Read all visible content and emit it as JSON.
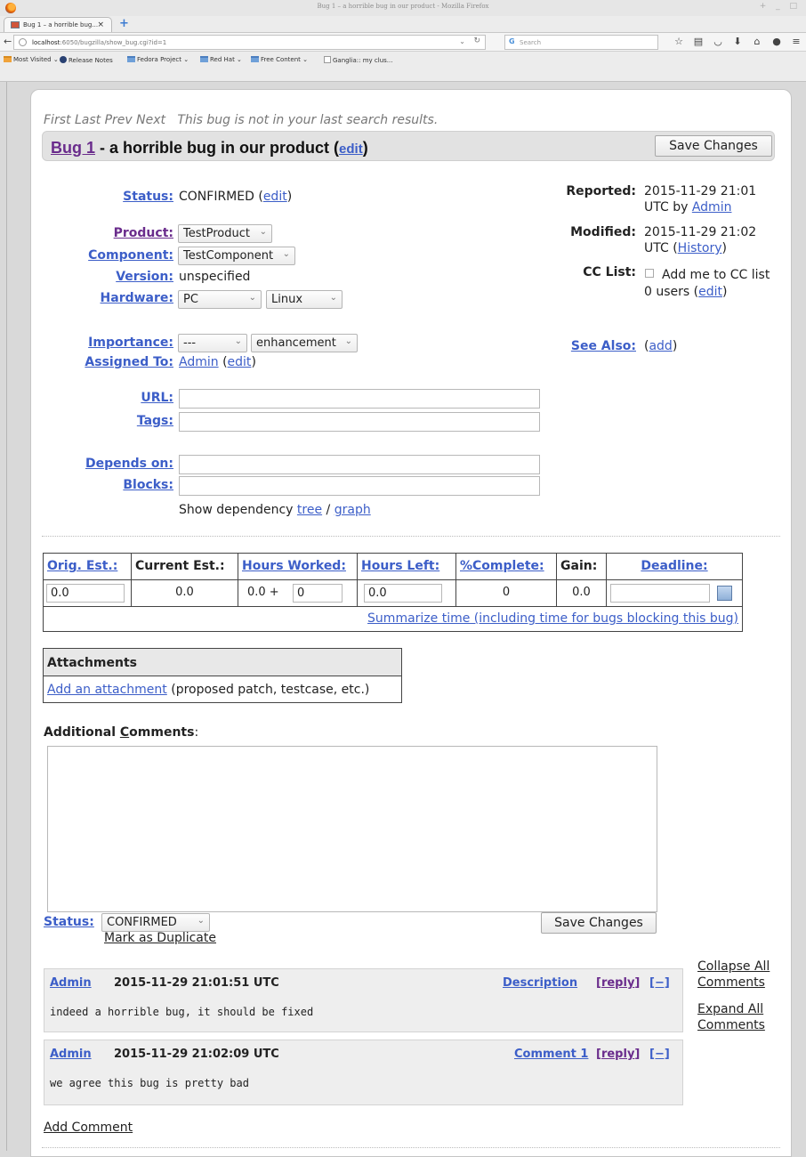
{
  "browser": {
    "window_title": "Bug 1 – a horrible bug in our product - Mozilla Firefox",
    "window_controls": "+ _ □",
    "tab_title": "Bug 1 – a horrible bug...",
    "tab_close": "×",
    "new_tab": "+",
    "url_host": "localhost",
    "url_rest": ":6050/bugzilla/show_bug.cgi?id=1",
    "search_placeholder": "Search",
    "bookmarks": [
      "Most Visited",
      "Release Notes",
      "Fedora Project",
      "Red Hat",
      "Free Content",
      "Ganglia:: my clus..."
    ]
  },
  "nav": {
    "first": "First",
    "last": "Last",
    "prev": "Prev",
    "next": "Next",
    "note": "This bug is not in your last search results."
  },
  "bug": {
    "id_label": "Bug 1",
    "summary": " - a horrible bug in our product ",
    "edit": "edit",
    "save_changes": "Save Changes"
  },
  "fields": {
    "status_label": "Status:",
    "status_value": "CONFIRMED",
    "status_edit": "edit",
    "product_label": "Product:",
    "product_value": "TestProduct",
    "component_label": "Component:",
    "component_value": "TestComponent",
    "version_label": "Version:",
    "version_value": "unspecified",
    "hardware_label": "Hardware:",
    "hardware_value": "PC",
    "os_value": "Linux",
    "importance_label": "Importance:",
    "priority_value": "---",
    "severity_value": "enhancement",
    "assigned_label": "Assigned To:",
    "assigned_value": "Admin",
    "assigned_edit": "edit",
    "url_label": "URL:",
    "tags_label": "Tags:",
    "depends_label": "Depends on:",
    "blocks_label": "Blocks:",
    "dep_text": "Show dependency",
    "dep_tree": "tree",
    "dep_sep": "/",
    "dep_graph": "graph"
  },
  "side": {
    "reported_label": "Reported:",
    "reported_line1": "2015-11-29 21:01",
    "reported_line2a": "UTC by",
    "reported_by": "Admin",
    "modified_label": "Modified:",
    "modified_line1": "2015-11-29 21:02",
    "modified_line2a": "UTC (",
    "modified_history": "History",
    "modified_line2b": ")",
    "cc_label": "CC List:",
    "cc_add": "Add me to CC list",
    "cc_users": "0 users (",
    "cc_edit": "edit",
    "cc_close": ")",
    "seealso_label": "See Also:",
    "seealso_add": "add"
  },
  "time": {
    "headers": {
      "orig": "Orig. Est.:",
      "current": "Current Est.:",
      "worked": "Hours Worked:",
      "left": "Hours Left:",
      "complete": "%Complete:",
      "gain": "Gain:",
      "deadline": "Deadline:"
    },
    "orig_value": "0.0",
    "current_value": "0.0",
    "worked_value": "0.0 +",
    "worked_add": "0",
    "left_value": "0.0",
    "complete_value": "0",
    "gain_value": "0.0",
    "deadline_value": "",
    "summarize": "Summarize time (including time for bugs blocking this bug)"
  },
  "attachments": {
    "title": "Attachments",
    "add": "Add an attachment",
    "hint": " (proposed patch, testcase, etc.)"
  },
  "comments_form": {
    "label_a": "Additional ",
    "label_c": "C",
    "label_b": "omments",
    "colon": ":",
    "status_label": "Status:",
    "status_value": "CONFIRMED",
    "mark_dup": "Mark as Duplicate",
    "save": "Save Changes"
  },
  "comments": [
    {
      "author": "Admin",
      "time": "2015-11-29 21:01:51 UTC",
      "label": "Description",
      "reply": "reply",
      "collapse": "[−]",
      "text": "indeed a horrible bug, it should be fixed"
    },
    {
      "author": "Admin",
      "time": "2015-11-29 21:02:09 UTC",
      "label": "Comment 1",
      "reply": "reply",
      "collapse": "[−]",
      "text": "we agree this bug is pretty bad"
    }
  ],
  "comment_actions": {
    "collapse_all_1": "Collapse All",
    "collapse_all_2": "Comments",
    "expand_all_1": "Expand All",
    "expand_all_2": "Comments",
    "add_comment": "Add Comment"
  }
}
